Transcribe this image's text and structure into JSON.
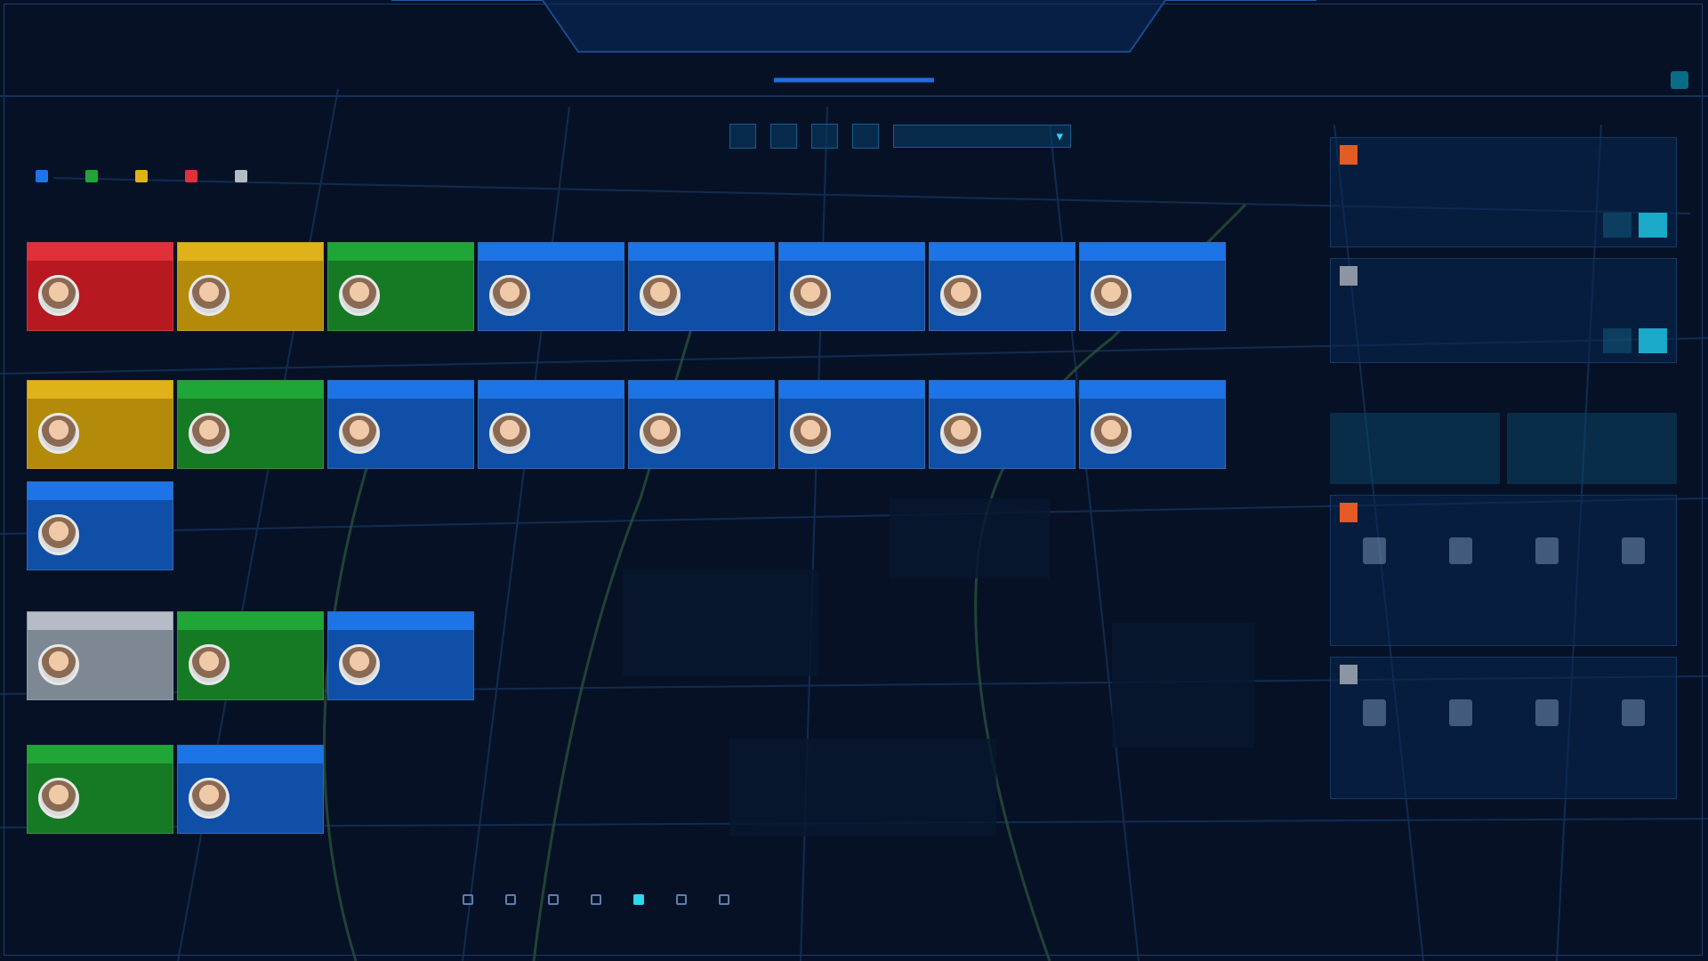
{
  "header": {
    "title": "",
    "subtitle": ""
  },
  "left_panel": {
    "title": "",
    "filters": [
      "",
      "",
      "",
      "",
      ""
    ],
    "search_placeholder": "",
    "legend": [
      {
        "label": "",
        "color": "#1d74e6"
      },
      {
        "label": "",
        "color": "#1fa637"
      },
      {
        "label": "",
        "color": "#e0b21a"
      },
      {
        "label": "",
        "color": "#e0303a"
      },
      {
        "label": "",
        "color": "#b5bcc5"
      }
    ],
    "legend_right": {
      "text1": "",
      "text2": "",
      "text3": "",
      "link": ""
    },
    "groups": [
      {
        "label": "",
        "cards": [
          {
            "status": "red"
          },
          {
            "status": "yellow"
          },
          {
            "status": "green"
          },
          {
            "status": "blue"
          },
          {
            "status": "blue"
          },
          {
            "status": "blue"
          },
          {
            "status": "blue"
          },
          {
            "status": "blue"
          }
        ]
      },
      {
        "label": "",
        "cards": [
          {
            "status": "yellow"
          },
          {
            "status": "green"
          },
          {
            "status": "blue"
          },
          {
            "status": "blue"
          },
          {
            "status": "blue"
          },
          {
            "status": "blue"
          },
          {
            "status": "blue"
          },
          {
            "status": "blue"
          },
          {
            "status": "blue"
          }
        ]
      },
      {
        "label": "",
        "cards": [
          {
            "status": "gray"
          },
          {
            "status": "green"
          },
          {
            "status": "blue"
          }
        ]
      },
      {
        "label": "",
        "cards": [
          {
            "status": "green"
          },
          {
            "status": "blue"
          }
        ]
      }
    ]
  },
  "right_panel": {
    "section1_title": "",
    "section2_title": "",
    "section2_action": "",
    "stats": [
      {
        "label": "",
        "value": ""
      },
      {
        "label": "",
        "value": ""
      }
    ]
  },
  "footer": {
    "items": [
      {
        "label": "",
        "active": false
      },
      {
        "label": "",
        "active": false
      },
      {
        "label": "",
        "active": false
      },
      {
        "label": "",
        "active": false
      },
      {
        "label": "",
        "active": true
      },
      {
        "label": "",
        "active": false
      },
      {
        "label": "",
        "active": false
      }
    ]
  }
}
